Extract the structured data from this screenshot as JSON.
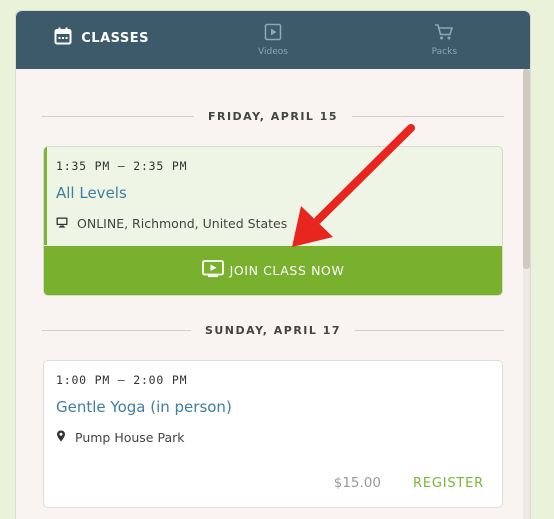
{
  "nav": {
    "tabs": [
      {
        "label": "CLASSES",
        "icon": "calendar-icon",
        "active": true
      },
      {
        "label": "Videos",
        "icon": "play-square-icon",
        "active": false
      },
      {
        "label": "Packs",
        "icon": "cart-icon",
        "active": false
      }
    ]
  },
  "schedule": [
    {
      "date_label": "FRIDAY, APRIL 15",
      "classes": [
        {
          "time": "1:35 PM — 2:35 PM",
          "title": "All Levels",
          "location": "ONLINE, Richmond, United States",
          "location_icon": "monitor-icon",
          "action_label": "JOIN CLASS NOW",
          "action_icon": "tv-play-icon"
        }
      ]
    },
    {
      "date_label": "SUNDAY, APRIL 17",
      "classes": [
        {
          "time": "1:00 PM — 2:00 PM",
          "title": "Gentle Yoga (in person)",
          "location": "Pump House Park",
          "location_icon": "map-pin-icon",
          "price": "$15.00",
          "action_label": "REGISTER"
        }
      ]
    }
  ],
  "colors": {
    "header": "#3d5a6b",
    "accent_green": "#79b12f",
    "link_blue": "#3e7ea3",
    "annotation_arrow": "#e8251f"
  }
}
